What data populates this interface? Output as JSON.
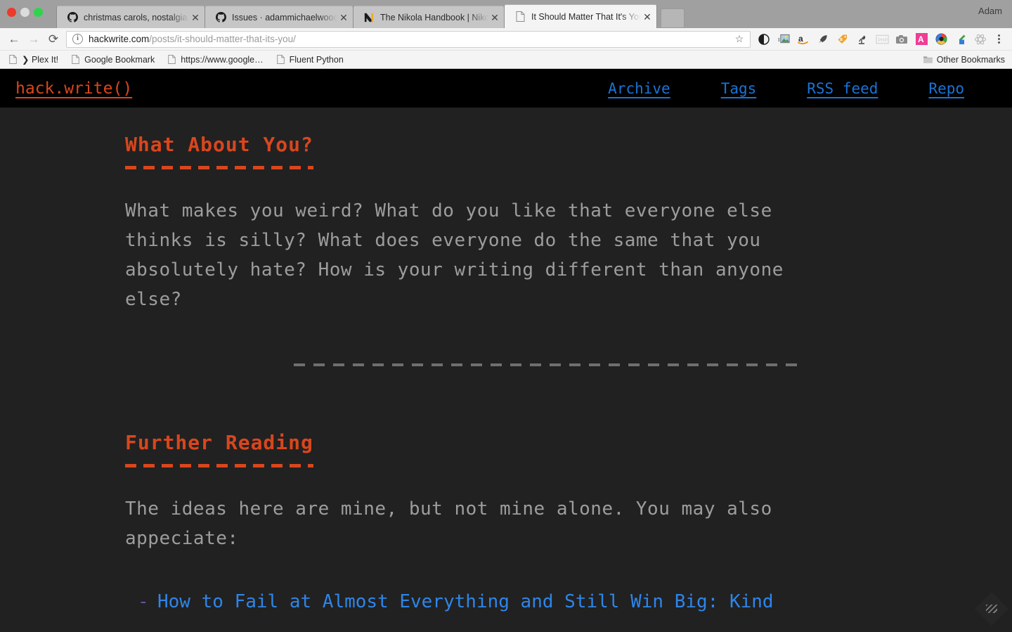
{
  "browser": {
    "profile_name": "Adam",
    "window_controls": [
      {
        "name": "close",
        "color": "#ed3a2b"
      },
      {
        "name": "minimize",
        "color": "#dcdcdc"
      },
      {
        "name": "zoom",
        "color": "#2ed44b"
      }
    ],
    "tabs": [
      {
        "title": "christmas carols, nostalgia, ho",
        "favicon": "github-icon",
        "active": false
      },
      {
        "title": "Issues · adammichaelwood/ada",
        "favicon": "github-icon",
        "active": false
      },
      {
        "title": "The Nikola Handbook | Nikola",
        "favicon": "nikola-icon",
        "active": false
      },
      {
        "title": "It Should Matter That It's You",
        "favicon": "page-icon",
        "active": true
      }
    ],
    "toolbar": {
      "back_label": "←",
      "forward_label": "→",
      "reload_label": "⟳",
      "url_host": "hackwrite.com",
      "url_path": "/posts/it-should-matter-that-its-you/",
      "url_full": "hackwrite.com/posts/it-should-matter-that-its-you/",
      "star_label": "☆",
      "extensions": [
        {
          "name": "contrast-extension-icon",
          "glyph": "◐",
          "color": "#1d1d1d"
        },
        {
          "name": "image-extension-icon",
          "glyph": "🖼",
          "color": "#5b8fbe"
        },
        {
          "name": "amazon-extension-icon",
          "glyph": "a",
          "color": "#e8921c"
        },
        {
          "name": "rocket-extension-icon",
          "glyph": "🚀",
          "color": "#4a4a4a"
        },
        {
          "name": "price-tag-extension-icon",
          "glyph": "🏷",
          "color": "#f0a42c"
        },
        {
          "name": "lamp-extension-icon",
          "glyph": "💡",
          "color": "#4a4a4a"
        },
        {
          "name": "php-extension-icon",
          "glyph": "PHP",
          "color": "#c9c9c9"
        },
        {
          "name": "camera-extension-icon",
          "glyph": "📷",
          "color": "#8a8a8a"
        },
        {
          "name": "grammarly-extension-icon",
          "glyph": "A",
          "color": "#ef3d95"
        },
        {
          "name": "color-picker-extension-icon",
          "glyph": "◉",
          "color": "#2c2c2c"
        },
        {
          "name": "eyedropper-extension-icon",
          "glyph": "✒",
          "color": "#2f7fe0"
        },
        {
          "name": "react-extension-icon",
          "glyph": "⚛",
          "color": "#b9b9b9"
        }
      ],
      "menu_label": "⋮"
    },
    "bookmarks": [
      {
        "label": "❯ Plex It!",
        "icon": "page-icon"
      },
      {
        "label": "Google Bookmark",
        "icon": "page-icon"
      },
      {
        "label": "https://www.google…",
        "icon": "page-icon"
      },
      {
        "label": "Fluent Python",
        "icon": "page-icon"
      }
    ],
    "other_bookmarks_label": "Other Bookmarks"
  },
  "site": {
    "brand": "hack.write()",
    "brand_color": "#d9461d",
    "link_color": "#1a73d4",
    "nav": [
      {
        "label": "Archive"
      },
      {
        "label": "Tags"
      },
      {
        "label": "RSS feed"
      },
      {
        "label": "Repo"
      }
    ]
  },
  "article": {
    "section_1": {
      "heading": "What About You?",
      "paragraph": "What makes you weird? What do you like that everyone else\nthinks is silly? What does everyone do the same that you\nabsolutely hate? How is your writing different than anyone\nelse?"
    },
    "section_2": {
      "heading": "Further Reading",
      "paragraph": "The ideas here are mine, but not mine alone. You may also\nappeciate:",
      "links": [
        {
          "dash": "-",
          "label": "How to Fail at Almost Everything and Still Win Big: Kind"
        }
      ]
    }
  },
  "colors": {
    "page_background": "#212121",
    "header_background": "#000000",
    "accent": "#d9461d",
    "body_text": "#9d9d9d",
    "link": "#2f85e8"
  }
}
